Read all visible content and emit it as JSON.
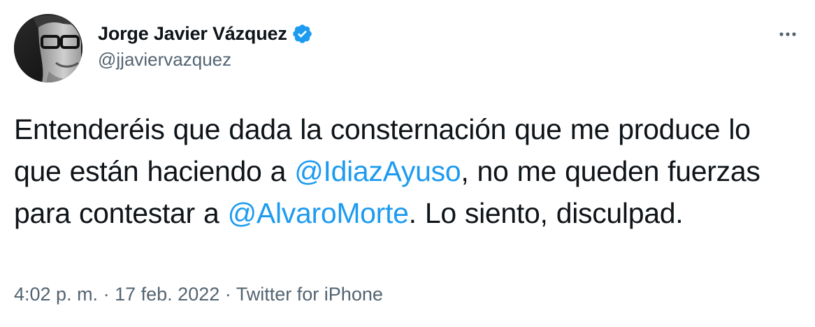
{
  "author": {
    "display_name": "Jorge Javier Vázquez",
    "handle": "@jjaviervazquez",
    "verified": true,
    "verified_color": "#1d9bf0"
  },
  "tweet": {
    "segments": [
      {
        "type": "text",
        "text": "Entenderéis que dada la consternación que me produce lo que están haciendo a "
      },
      {
        "type": "mention",
        "text": "@IdiazAyuso"
      },
      {
        "type": "text",
        "text": ", no me queden fuerzas para contestar a "
      },
      {
        "type": "mention",
        "text": "@AlvaroMorte"
      },
      {
        "type": "text",
        "text": ". Lo siento, disculpad."
      }
    ]
  },
  "meta": {
    "time": "4:02 p. m.",
    "separator": "·",
    "date": "17 feb. 2022",
    "source": "Twitter for iPhone"
  },
  "colors": {
    "text": "#0f1419",
    "secondary": "#536471",
    "link": "#1d9bf0"
  },
  "icons": {
    "more": "more-horizontal-icon",
    "verified": "verified-badge-icon"
  }
}
